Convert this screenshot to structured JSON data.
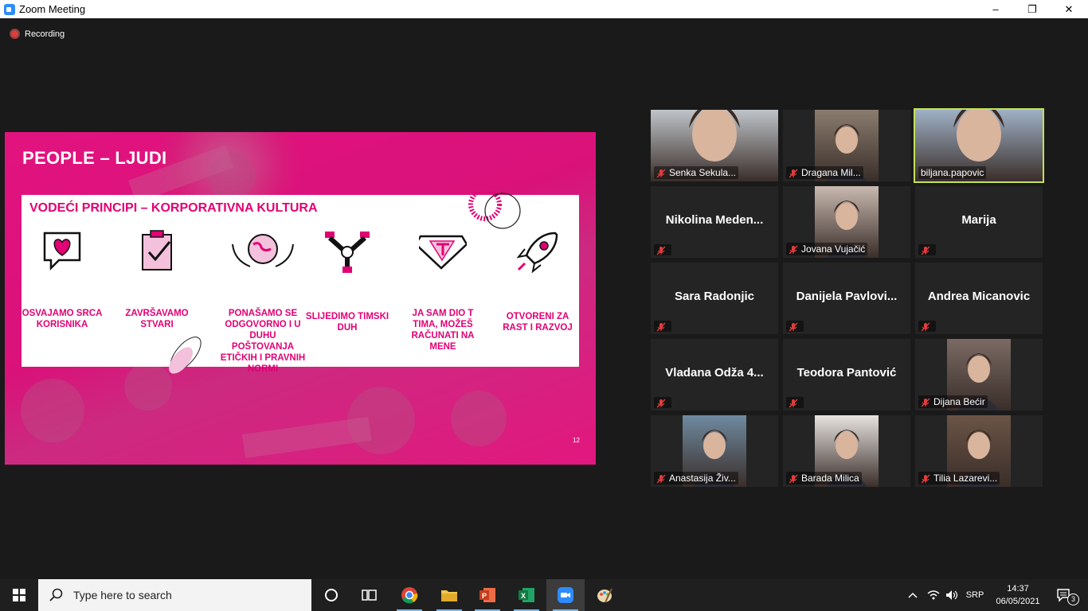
{
  "window": {
    "title": "Zoom Meeting",
    "controls": {
      "minimize": "–",
      "maximize": "❐",
      "close": "✕"
    }
  },
  "recording": {
    "label": "Recording"
  },
  "slide": {
    "title": "PEOPLE – LJUDI",
    "heading": "VODEĆI PRINCIPI – KORPORATIVNA KULTURA",
    "principles": [
      {
        "icon": "heart-speech-bubble-icon",
        "label": "OSVAJAMO SRCA KORISNIKA"
      },
      {
        "icon": "clipboard-check-icon",
        "label": "ZAVRŠAVAMO STVARI"
      },
      {
        "icon": "hands-globe-icon",
        "label": "PONAŠAMO SE ODGOVORNO I U DUHU POŠTOVANJA ETIČKIH I PRAVNIH NORMI"
      },
      {
        "icon": "team-hands-icon",
        "label": "SLIJEDIMO TIMSKI DUH"
      },
      {
        "icon": "super-t-emblem-icon",
        "label": "JA SAM DIO T TIMA, MOŽEŠ RAČUNATI NA MENE"
      },
      {
        "icon": "rocket-icon",
        "label": "OTVORENI ZA RAST I RAZVOJ"
      }
    ],
    "page_number": "12",
    "brand_color": "#e20074"
  },
  "participants": [
    {
      "name": "Senka Sekula...",
      "video": true,
      "muted": true,
      "active": false,
      "photo": "#bfc4c9"
    },
    {
      "name": "Dragana Mil...",
      "video": true,
      "muted": true,
      "active": false,
      "photo": "#8a7c6e"
    },
    {
      "name": "biljana.papovic",
      "video": true,
      "muted": false,
      "active": true,
      "photo": "#9fb1c6"
    },
    {
      "name": "Nikolina  Meden...",
      "video": false,
      "muted": true,
      "active": false
    },
    {
      "name": "Jovana Vujačić",
      "video": true,
      "muted": true,
      "active": false,
      "photo": "#c9b9b0"
    },
    {
      "name": "Marija",
      "video": false,
      "muted": true,
      "active": false
    },
    {
      "name": "Sara Radonjic",
      "video": false,
      "muted": true,
      "active": false
    },
    {
      "name": "Danijela  Pavlovi...",
      "video": false,
      "muted": true,
      "active": false
    },
    {
      "name": "Andrea Micanovic",
      "video": false,
      "muted": true,
      "active": false
    },
    {
      "name": "Vladana  Odža  4...",
      "video": false,
      "muted": true,
      "active": false
    },
    {
      "name": "Teodora Pantović",
      "video": false,
      "muted": true,
      "active": false
    },
    {
      "name": "Dijana Bećir",
      "video": true,
      "muted": true,
      "active": false,
      "photo": "#7a6a63"
    },
    {
      "name": "Anastasija Živ...",
      "video": true,
      "muted": true,
      "active": false,
      "photo": "#6f8aa0"
    },
    {
      "name": "Barada Milica",
      "video": true,
      "muted": true,
      "active": false,
      "photo": "#e8e3df"
    },
    {
      "name": "Tilia Lazarevi...",
      "video": true,
      "muted": true,
      "active": false,
      "photo": "#6b5446"
    }
  ],
  "taskbar": {
    "search_placeholder": "Type here to search",
    "apps": [
      "task-view",
      "chrome",
      "file-explorer",
      "powerpoint",
      "excel",
      "zoom",
      "paint"
    ],
    "language": "SRP",
    "time": "14:37",
    "date": "06/05/2021",
    "notification_count": "3"
  }
}
